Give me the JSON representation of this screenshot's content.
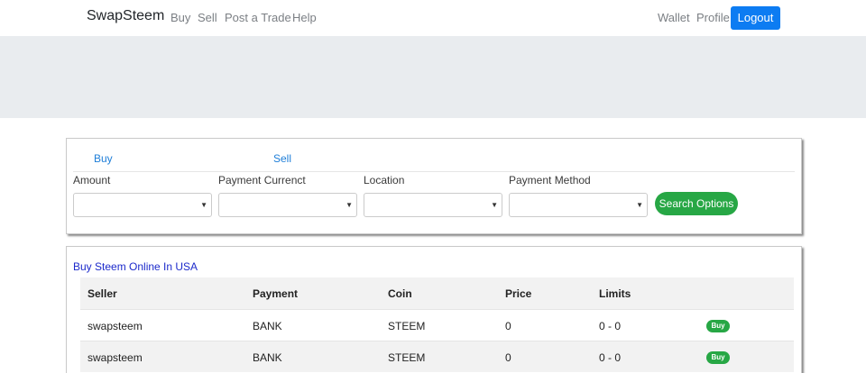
{
  "navbar": {
    "brand": "SwapSteem",
    "links": [
      "Buy",
      "Sell",
      "Post a Trade",
      "Help"
    ],
    "right_links": [
      "Wallet",
      "Profile"
    ],
    "logout_label": "Logout"
  },
  "search": {
    "tabs": [
      "Buy",
      "Sell"
    ],
    "fields": [
      "Amount",
      "Payment Currenct",
      "Location",
      "Payment Method"
    ],
    "button_label": "Search Options"
  },
  "listing": {
    "heading": "Buy Steem Online In USA",
    "columns": [
      "Seller",
      "Payment",
      "Coin",
      "Price",
      "Limits"
    ],
    "rows": [
      {
        "seller": "swapsteem",
        "payment": "BANK",
        "coin": "STEEM",
        "price": "0",
        "limits": "0 - 0",
        "action": "Buy"
      },
      {
        "seller": "swapsteem",
        "payment": "BANK",
        "coin": "STEEM",
        "price": "0",
        "limits": "0 - 0",
        "action": "Buy"
      }
    ]
  },
  "colors": {
    "primary": "#0d7cf2",
    "success": "#27a745",
    "banner": "#e9ecef",
    "heading_link": "#1c2acb"
  }
}
